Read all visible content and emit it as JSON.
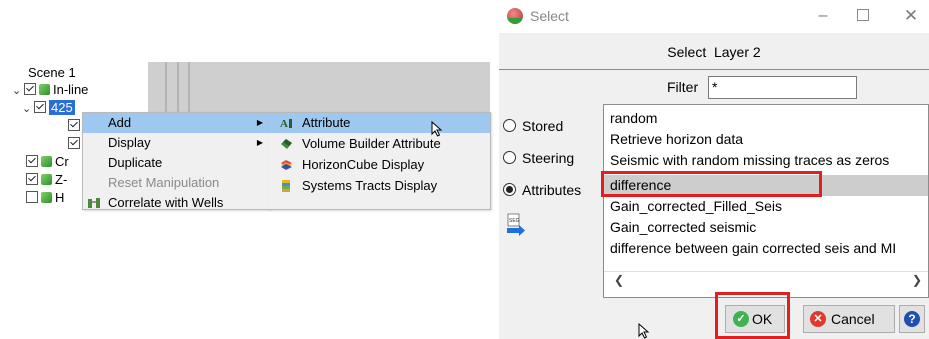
{
  "tree": {
    "scene": "Scene 1",
    "inline": "In-line",
    "item_425": "425",
    "row_cr": "Cr",
    "row_z": "Z-",
    "row_h": "H"
  },
  "context_menu": {
    "items": [
      {
        "label": "Add",
        "submenu": true,
        "active": true,
        "disabled": false
      },
      {
        "label": "Display",
        "submenu": true,
        "active": false,
        "disabled": false
      },
      {
        "label": "Duplicate",
        "submenu": false,
        "active": false,
        "disabled": false
      },
      {
        "label": "Reset Manipulation",
        "submenu": false,
        "active": false,
        "disabled": true
      },
      {
        "label": "Correlate with Wells",
        "submenu": false,
        "active": false,
        "disabled": false
      }
    ],
    "arrow_glyph": "▶"
  },
  "add_submenu": {
    "items": [
      {
        "label": "Attribute",
        "icon": "attribute-icon",
        "active": true
      },
      {
        "label": "Volume Builder Attribute",
        "icon": "volume-builder-icon",
        "active": false
      },
      {
        "label": "HorizonCube Display",
        "icon": "horizoncube-icon",
        "active": false
      },
      {
        "label": "Systems Tracts Display",
        "icon": "systems-tracts-icon",
        "active": false
      }
    ]
  },
  "dialog": {
    "title": "Select",
    "heading": "Select  Layer 2",
    "filter_label": "Filter",
    "filter_value": "*",
    "radios": [
      {
        "label": "Stored",
        "selected": false
      },
      {
        "label": "Steering",
        "selected": false
      },
      {
        "label": "Attributes",
        "selected": true
      }
    ],
    "list_items": [
      "random",
      "Retrieve horizon data",
      "Seismic with random missing traces as zeros",
      "difference",
      "Gain_corrected_Filled_Seis",
      "Gain_corrected seismic",
      "difference between gain corrected seis and MI"
    ],
    "selected_item": "difference",
    "ok_label": "OK",
    "cancel_label": "Cancel",
    "help_label": "?",
    "highlight_color": "#e02020"
  }
}
